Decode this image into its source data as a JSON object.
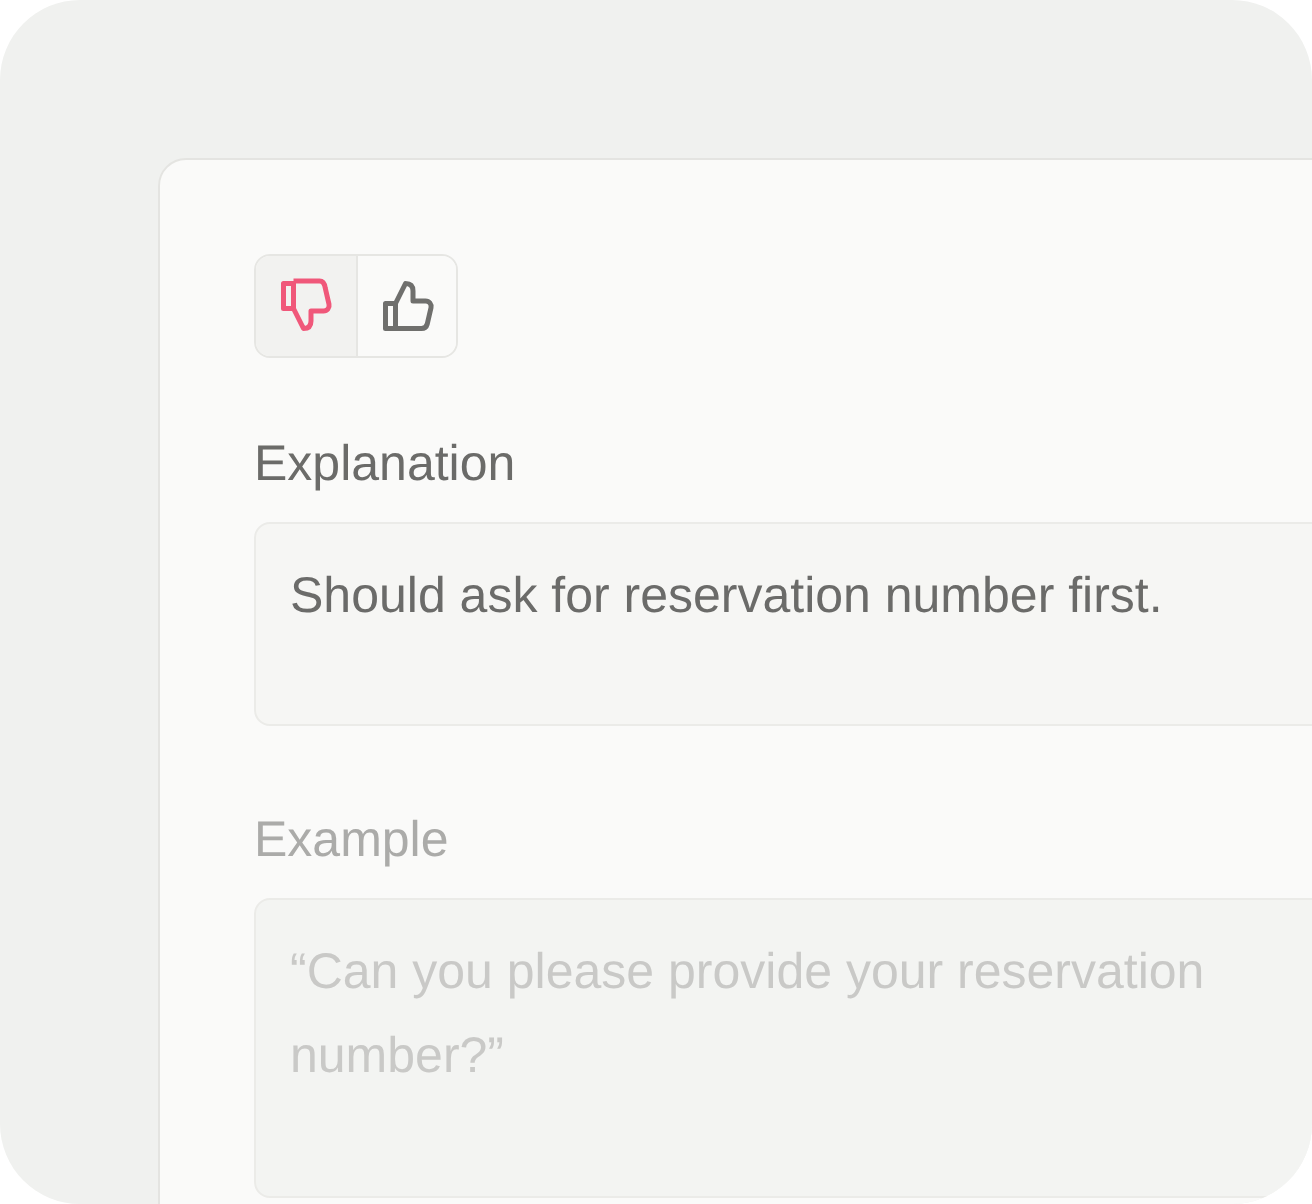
{
  "rating": [
    {
      "kind": "thumbs-down",
      "selected": true
    },
    {
      "kind": "thumbs-up",
      "selected": false
    }
  ],
  "fields": [
    {
      "label": "Explanation",
      "value": "Should ask for reservation number first.",
      "disabled": false
    },
    {
      "label": "Example",
      "value": "“Can you please provide your reservation number?”",
      "disabled": true
    }
  ]
}
